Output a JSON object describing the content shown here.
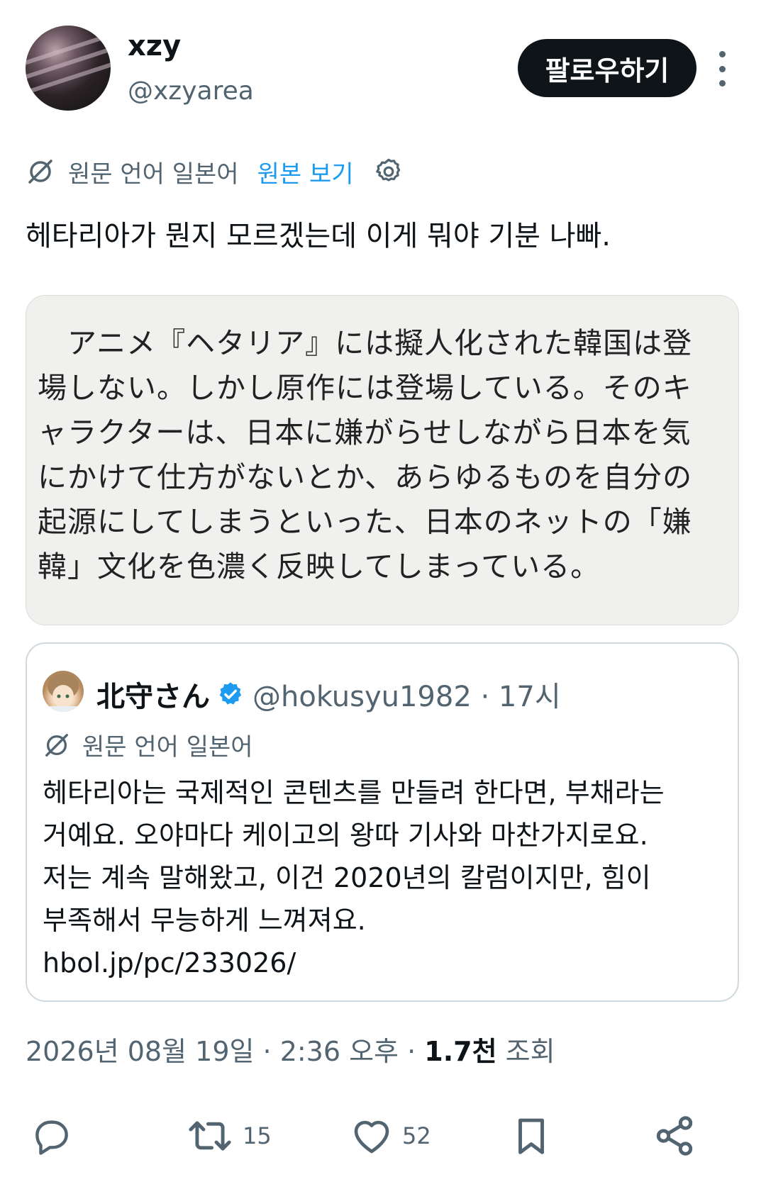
{
  "author": {
    "display_name": "xzy",
    "handle": "@xzyarea"
  },
  "follow_button": {
    "label": "팔로우하기"
  },
  "translation": {
    "source_language": "원문 언어 일본어",
    "show_original": "원본 보기"
  },
  "tweet_text": "헤타리아가 뭔지 모르겠는데 이게 뭐야 기분 나빠.",
  "image_text_lines": [
    "　アニメ『ヘタリア』には擬人化された韓国は登",
    "場しない。しかし原作には登場している。そのキ",
    "ャラクターは、日本に嫌がらせしながら日本を気",
    "にかけて仕方がないとか、あらゆるものを自分の",
    "起源にしてしまうといった、日本のネットの「嫌",
    "韓」文化を色濃く反映してしまっている。"
  ],
  "quote": {
    "display_name": "北守さん",
    "handle_time": "@hokusyu1982 · 17시",
    "source_language": "원문 언어 일본어",
    "text_lines": [
      "헤타리아는 국제적인 콘텐츠를 만들려 한다면, 부채라는",
      "거예요. 오야마다 케이고의 왕따 기사와 마찬가지로요.",
      "저는 계속 말해왔고, 이건 2020년의 칼럼이지만, 힘이",
      "부족해서 무능하게 느껴져요.",
      "hbol.jp/pc/233026/"
    ]
  },
  "meta": {
    "datetime": "2026년 08월 19일 · 2:36 오후 · ",
    "views_count": "1.7천",
    "views_label": " 조회"
  },
  "actions": {
    "retweets": "15",
    "likes": "52"
  },
  "icons": {
    "translate": "translate-icon",
    "gear": "gear-icon",
    "verified": "verified-badge-icon",
    "reply": "reply-icon",
    "retweet": "retweet-icon",
    "like": "heart-icon",
    "bookmark": "bookmark-icon",
    "share": "share-icon"
  },
  "colors": {
    "text": "#0f1419",
    "secondary": "#536471",
    "link": "#1d9bf0",
    "button_bg": "#0f1419"
  }
}
